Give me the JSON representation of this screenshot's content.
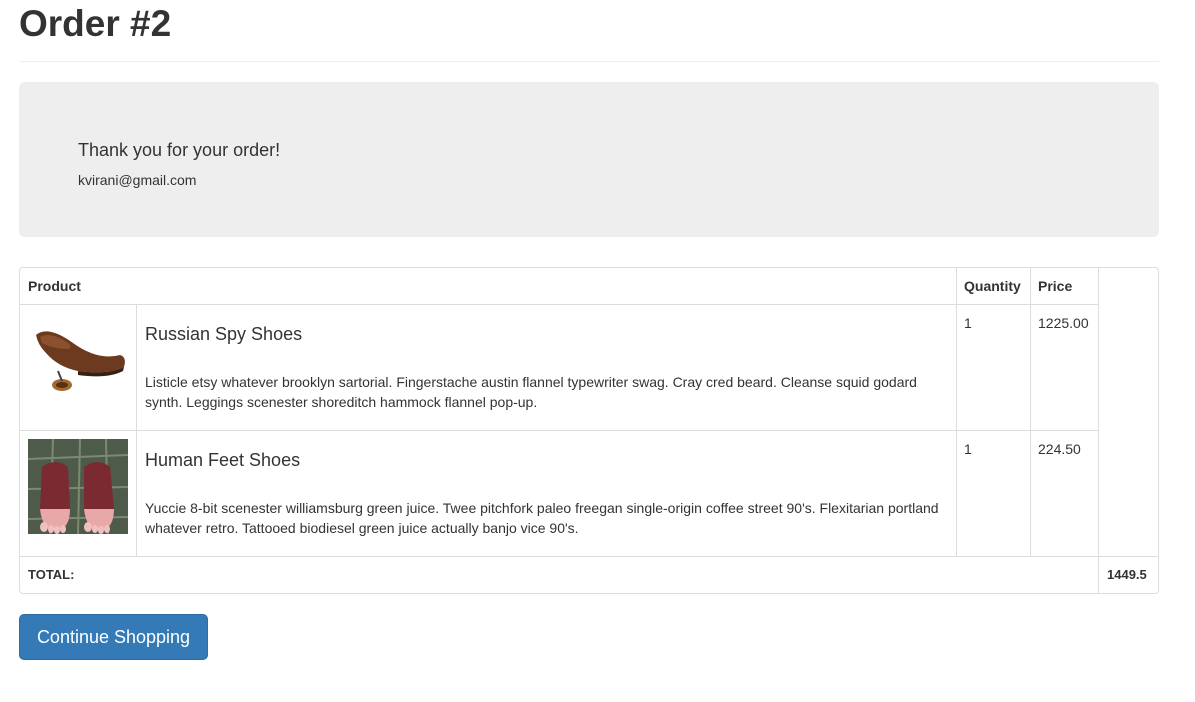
{
  "page": {
    "title": "Order #2"
  },
  "confirmation": {
    "heading": "Thank you for your order!",
    "email": "kvirani@gmail.com"
  },
  "table": {
    "headers": {
      "product": "Product",
      "quantity": "Quantity",
      "price": "Price"
    },
    "items": [
      {
        "name": "Russian Spy Shoes",
        "description": "Listicle etsy whatever brooklyn sartorial. Fingerstache austin flannel typewriter swag. Cray cred beard. Cleanse squid godard synth. Leggings scenester shoreditch hammock flannel pop-up.",
        "quantity": "1",
        "price": "1225.00",
        "image_icon": "brown-spy-shoe-image"
      },
      {
        "name": "Human Feet Shoes",
        "description": "Yuccie 8-bit scenester williamsburg green juice. Twee pitchfork paleo freegan single-origin coffee street 90's. Flexitarian portland whatever retro. Tattooed biodiesel green juice actually banjo vice 90's.",
        "quantity": "1",
        "price": "224.50",
        "image_icon": "human-feet-shoes-image"
      }
    ],
    "total_label": "TOTAL:",
    "total_value": "1449.5"
  },
  "actions": {
    "continue_label": "Continue Shopping"
  },
  "colors": {
    "primary_button": "#337ab7",
    "jumbotron_bg": "#eeeeee",
    "border": "#dddddd",
    "text": "#333333"
  }
}
